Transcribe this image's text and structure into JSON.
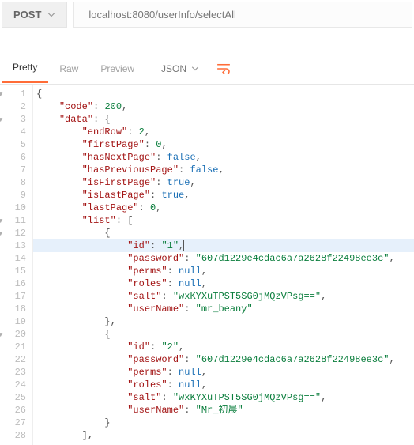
{
  "request": {
    "method": "POST",
    "url": "localhost:8080/userInfo/selectAll"
  },
  "tabs": {
    "pretty": "Pretty",
    "raw": "Raw",
    "preview": "Preview",
    "body_format": "JSON"
  },
  "lines": [
    {
      "n": 1,
      "fold": true,
      "indent": 0,
      "seg": [
        {
          "t": "{",
          "c": "p"
        }
      ]
    },
    {
      "n": 2,
      "fold": false,
      "indent": 1,
      "seg": [
        {
          "t": "\"code\"",
          "c": "k"
        },
        {
          "t": ": ",
          "c": "p"
        },
        {
          "t": "200",
          "c": "n"
        },
        {
          "t": ",",
          "c": "p"
        }
      ]
    },
    {
      "n": 3,
      "fold": true,
      "indent": 1,
      "seg": [
        {
          "t": "\"data\"",
          "c": "k"
        },
        {
          "t": ": {",
          "c": "p"
        }
      ]
    },
    {
      "n": 4,
      "fold": false,
      "indent": 2,
      "seg": [
        {
          "t": "\"endRow\"",
          "c": "k"
        },
        {
          "t": ": ",
          "c": "p"
        },
        {
          "t": "2",
          "c": "n"
        },
        {
          "t": ",",
          "c": "p"
        }
      ]
    },
    {
      "n": 5,
      "fold": false,
      "indent": 2,
      "seg": [
        {
          "t": "\"firstPage\"",
          "c": "k"
        },
        {
          "t": ": ",
          "c": "p"
        },
        {
          "t": "0",
          "c": "n"
        },
        {
          "t": ",",
          "c": "p"
        }
      ]
    },
    {
      "n": 6,
      "fold": false,
      "indent": 2,
      "seg": [
        {
          "t": "\"hasNextPage\"",
          "c": "k"
        },
        {
          "t": ": ",
          "c": "p"
        },
        {
          "t": "false",
          "c": "b"
        },
        {
          "t": ",",
          "c": "p"
        }
      ]
    },
    {
      "n": 7,
      "fold": false,
      "indent": 2,
      "seg": [
        {
          "t": "\"hasPreviousPage\"",
          "c": "k"
        },
        {
          "t": ": ",
          "c": "p"
        },
        {
          "t": "false",
          "c": "b"
        },
        {
          "t": ",",
          "c": "p"
        }
      ]
    },
    {
      "n": 8,
      "fold": false,
      "indent": 2,
      "seg": [
        {
          "t": "\"isFirstPage\"",
          "c": "k"
        },
        {
          "t": ": ",
          "c": "p"
        },
        {
          "t": "true",
          "c": "b"
        },
        {
          "t": ",",
          "c": "p"
        }
      ]
    },
    {
      "n": 9,
      "fold": false,
      "indent": 2,
      "seg": [
        {
          "t": "\"isLastPage\"",
          "c": "k"
        },
        {
          "t": ": ",
          "c": "p"
        },
        {
          "t": "true",
          "c": "b"
        },
        {
          "t": ",",
          "c": "p"
        }
      ]
    },
    {
      "n": 10,
      "fold": false,
      "indent": 2,
      "seg": [
        {
          "t": "\"lastPage\"",
          "c": "k"
        },
        {
          "t": ": ",
          "c": "p"
        },
        {
          "t": "0",
          "c": "n"
        },
        {
          "t": ",",
          "c": "p"
        }
      ]
    },
    {
      "n": 11,
      "fold": true,
      "indent": 2,
      "seg": [
        {
          "t": "\"list\"",
          "c": "k"
        },
        {
          "t": ": [",
          "c": "p"
        }
      ]
    },
    {
      "n": 12,
      "fold": true,
      "indent": 3,
      "seg": [
        {
          "t": "{",
          "c": "p"
        }
      ]
    },
    {
      "n": 13,
      "fold": false,
      "indent": 4,
      "hl": true,
      "caret": true,
      "seg": [
        {
          "t": "\"id\"",
          "c": "k"
        },
        {
          "t": ": ",
          "c": "p"
        },
        {
          "t": "\"1\"",
          "c": "s"
        },
        {
          "t": ",",
          "c": "p"
        }
      ]
    },
    {
      "n": 14,
      "fold": false,
      "indent": 4,
      "seg": [
        {
          "t": "\"password\"",
          "c": "k"
        },
        {
          "t": ": ",
          "c": "p"
        },
        {
          "t": "\"607d1229e4cdac6a7a2628f22498ee3c\"",
          "c": "s"
        },
        {
          "t": ",",
          "c": "p"
        }
      ]
    },
    {
      "n": 15,
      "fold": false,
      "indent": 4,
      "seg": [
        {
          "t": "\"perms\"",
          "c": "k"
        },
        {
          "t": ": ",
          "c": "p"
        },
        {
          "t": "null",
          "c": "b"
        },
        {
          "t": ",",
          "c": "p"
        }
      ]
    },
    {
      "n": 16,
      "fold": false,
      "indent": 4,
      "seg": [
        {
          "t": "\"roles\"",
          "c": "k"
        },
        {
          "t": ": ",
          "c": "p"
        },
        {
          "t": "null",
          "c": "b"
        },
        {
          "t": ",",
          "c": "p"
        }
      ]
    },
    {
      "n": 17,
      "fold": false,
      "indent": 4,
      "seg": [
        {
          "t": "\"salt\"",
          "c": "k"
        },
        {
          "t": ": ",
          "c": "p"
        },
        {
          "t": "\"wxKYXuTPST5SG0jMQzVPsg==\"",
          "c": "s"
        },
        {
          "t": ",",
          "c": "p"
        }
      ]
    },
    {
      "n": 18,
      "fold": false,
      "indent": 4,
      "seg": [
        {
          "t": "\"userName\"",
          "c": "k"
        },
        {
          "t": ": ",
          "c": "p"
        },
        {
          "t": "\"mr_beany\"",
          "c": "s"
        }
      ]
    },
    {
      "n": 19,
      "fold": false,
      "indent": 3,
      "seg": [
        {
          "t": "},",
          "c": "p"
        }
      ]
    },
    {
      "n": 20,
      "fold": true,
      "indent": 3,
      "seg": [
        {
          "t": "{",
          "c": "p"
        }
      ]
    },
    {
      "n": 21,
      "fold": false,
      "indent": 4,
      "seg": [
        {
          "t": "\"id\"",
          "c": "k"
        },
        {
          "t": ": ",
          "c": "p"
        },
        {
          "t": "\"2\"",
          "c": "s"
        },
        {
          "t": ",",
          "c": "p"
        }
      ]
    },
    {
      "n": 22,
      "fold": false,
      "indent": 4,
      "seg": [
        {
          "t": "\"password\"",
          "c": "k"
        },
        {
          "t": ": ",
          "c": "p"
        },
        {
          "t": "\"607d1229e4cdac6a7a2628f22498ee3c\"",
          "c": "s"
        },
        {
          "t": ",",
          "c": "p"
        }
      ]
    },
    {
      "n": 23,
      "fold": false,
      "indent": 4,
      "seg": [
        {
          "t": "\"perms\"",
          "c": "k"
        },
        {
          "t": ": ",
          "c": "p"
        },
        {
          "t": "null",
          "c": "b"
        },
        {
          "t": ",",
          "c": "p"
        }
      ]
    },
    {
      "n": 24,
      "fold": false,
      "indent": 4,
      "seg": [
        {
          "t": "\"roles\"",
          "c": "k"
        },
        {
          "t": ": ",
          "c": "p"
        },
        {
          "t": "null",
          "c": "b"
        },
        {
          "t": ",",
          "c": "p"
        }
      ]
    },
    {
      "n": 25,
      "fold": false,
      "indent": 4,
      "seg": [
        {
          "t": "\"salt\"",
          "c": "k"
        },
        {
          "t": ": ",
          "c": "p"
        },
        {
          "t": "\"wxKYXuTPST5SG0jMQzVPsg==\"",
          "c": "s"
        },
        {
          "t": ",",
          "c": "p"
        }
      ]
    },
    {
      "n": 26,
      "fold": false,
      "indent": 4,
      "seg": [
        {
          "t": "\"userName\"",
          "c": "k"
        },
        {
          "t": ": ",
          "c": "p"
        },
        {
          "t": "\"Mr_初晨\"",
          "c": "s"
        }
      ]
    },
    {
      "n": 27,
      "fold": false,
      "indent": 3,
      "seg": [
        {
          "t": "}",
          "c": "p"
        }
      ]
    },
    {
      "n": 28,
      "fold": false,
      "indent": 2,
      "seg": [
        {
          "t": "],",
          "c": "p"
        }
      ]
    }
  ]
}
